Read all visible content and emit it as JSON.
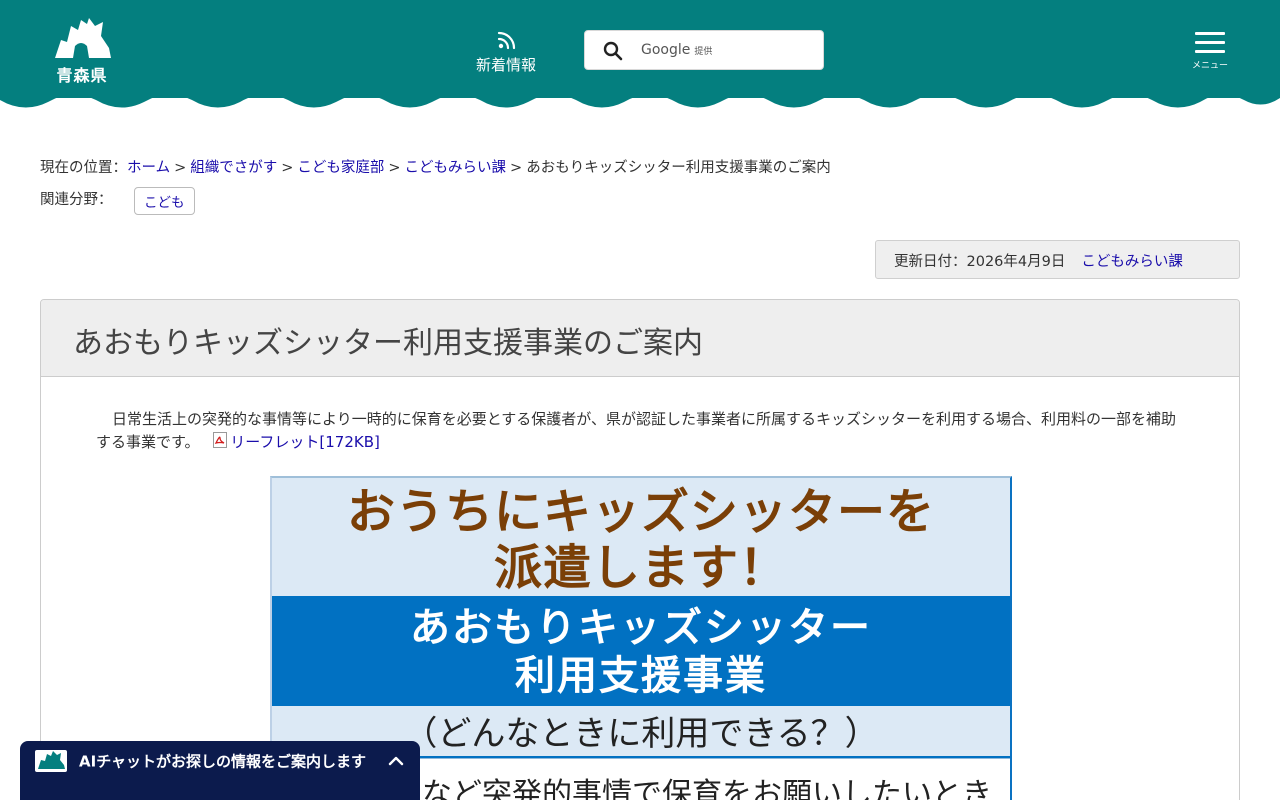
{
  "header": {
    "logo_text": "青森県",
    "news_label": "新着情報",
    "search": {
      "provider": "Google",
      "provider_suffix": "提供"
    },
    "menu_label": "メニュー",
    "colors": {
      "header_bg": "#047f7f",
      "link": "#1a0dab"
    }
  },
  "breadcrumb": {
    "prefix": "現在の位置：",
    "separator": ">",
    "items": [
      "ホーム",
      "組織でさがす",
      "こども家庭部",
      "こどもみらい課"
    ],
    "current": "あおもりキッズシッター利用支援事業のご案内"
  },
  "related": {
    "label": "関連分野：",
    "tag": "こども"
  },
  "updated": {
    "text": "更新日付：2026年4月9日",
    "department": "こどもみらい課"
  },
  "article": {
    "title": "あおもりキッズシッター利用支援事業のご案内",
    "intro": "日常生活上の突発的な事情等により一時的に保育を必要とする保護者が、県が認証した事業者に所属するキッズシッターを利用する場合、利用料の一部を補助する事業です。",
    "pdf_link": "リーフレット[172KB]"
  },
  "flyer": {
    "headline_1": "おうちにキッズシッターを",
    "headline_2": "派遣します！",
    "program_1": "あおもりキッズシッター",
    "program_2": "利用支援事業",
    "question": "（どんなときに利用できる？）",
    "row_1": "など突発的事情で保育をお願いしたいとき",
    "colors": {
      "headline": "#7a3f07",
      "band": "#0171c2",
      "bg": "#dce9f5"
    }
  },
  "chat": {
    "label": "AIチャットがお探しの情報をご案内します",
    "bg_color": "#0c1b4d"
  }
}
